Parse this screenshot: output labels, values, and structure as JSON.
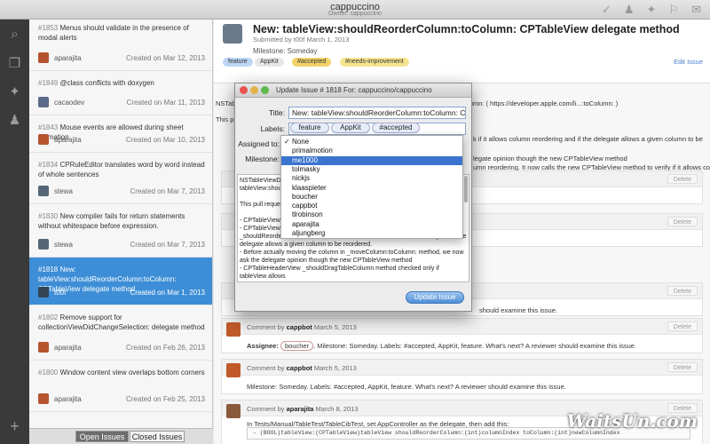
{
  "window": {
    "title": "cappuccino",
    "owner": "Owner: cappuccino"
  },
  "toolbar": {
    "icons": [
      "checkmark-icon",
      "user-icon",
      "milestone-icon",
      "label-icon",
      "comment-icon"
    ],
    "glyphs": [
      "✓",
      "♟",
      "✦",
      "⚐",
      "✉"
    ]
  },
  "sidebar": {
    "icons": [
      "search-icon",
      "document-icon",
      "milestone-icon",
      "user-icon"
    ],
    "glyphs": [
      "⌕",
      "❐",
      "✦",
      "♟"
    ],
    "add": "+"
  },
  "issues": [
    {
      "num": "#1853",
      "title": "Menus should validate in the presence of modal alerts",
      "user": "aparajita",
      "date": "Created on Mar 12, 2013"
    },
    {
      "num": "#1849",
      "title": "@class conflicts with doxygen",
      "user": "cacaodev",
      "date": "Created on Mar 11, 2013"
    },
    {
      "num": "#1843",
      "title": "Mouse events are allowed during sheet animation",
      "user": "aparajita",
      "date": "Created on Mar 10, 2013"
    },
    {
      "num": "#1834",
      "title": "CPRuleEditor translates word by word instead of whole sentences",
      "user": "stewa",
      "date": "Created on Mar 7, 2013"
    },
    {
      "num": "#1830",
      "title": "New compiler fails for return statements without whitespace before expression.",
      "user": "stewa",
      "date": "Created on Mar 7, 2013"
    },
    {
      "num": "#1818",
      "title": "New: tableView:shouldReorderColumn:toColumn: CPTableView delegate method",
      "user": "t00f",
      "date": "Created on Mar 1, 2013"
    },
    {
      "num": "#1802",
      "title": "Remove support for collectionViewDidChangeSelection: delegate method",
      "user": "aparajita",
      "date": "Created on Feb 26, 2013"
    },
    {
      "num": "#1800",
      "title": "Window content view overlaps bottom corners",
      "user": "aparajita",
      "date": "Created on Feb 25, 2013"
    }
  ],
  "tabs": {
    "open": "Open Issues",
    "closed": "Closed Issues"
  },
  "detail": {
    "title": "New: tableView:shouldReorderColumn:toColumn: CPTableView delegate method",
    "submitted": "Submitted by t00f March 1, 2013",
    "milestone": "Milestone: Someday",
    "labels": [
      {
        "text": "feature",
        "bg": "#bcd6f4"
      },
      {
        "text": "AppKit",
        "bg": "#e6e6e6"
      },
      {
        "text": "#accepted",
        "bg": "#f2d36a"
      },
      {
        "text": "#needs-improvement",
        "bg": "#f6e58f"
      }
    ],
    "edit": "Edit Issue",
    "desc_line": "NSTableViewDelegate implements the method tableView:shouldReorderColumn:toColumn: ( https://developer.apple.com/li...:toColumn: )",
    "bg_lines": [
      "This pull request adds the method in cappuccino. This is implemented in 4 points:",
      "k if it allows column reordering and if the delegate allows a given column to be",
      "legate opinion though the new CPTableView method",
      "umn reordering. It now calls the new CPTableView method to verify if it allows column"
    ]
  },
  "comments": [
    {
      "by": "Comment by",
      "user": "cappbot",
      "date": "March 5, 2013",
      "assignee": "Assignee:",
      "assignee_val": "boucher",
      "rest": ", Milestone: Someday. Labels: #accepted, AppKit, feature. What's next? A reviewer should examine this issue."
    },
    {
      "by": "Comment by",
      "user": "cappbot",
      "date": "March 5, 2013",
      "milestone": "Milestone: Someday. Labels: #accepted, AppKit, feature. What's next? A reviewer should examine this issue."
    },
    {
      "by": "Comment by",
      "user": "aparajita",
      "date": "March 8, 2013",
      "body": "In Tests/Manual/TableTest/TableCibTest, set AppController as the delegate, then add this:",
      "code": "- (BOOL)tableView:(CPTableView)tableView shouldReorderColumn:(int)columnIndex toColumn:(int)newColumnIndex"
    }
  ],
  "partial_comment": {
    "tail": "should examine this issue."
  },
  "delete": "Delete",
  "sheet": {
    "title": "Update Issue # 1818 For: cappuccino/cappuccino",
    "title_label": "Title:",
    "title_value": "New: tableView:shouldReorderColumn:toColumn: CPTab",
    "labels_label": "Labels:",
    "label_chips": [
      "feature",
      "AppKit",
      "#accepted"
    ],
    "assigned_label": "Assigned to:",
    "milestone_label": "Milestone:",
    "body": "NSTableViewDel... tableView:shoul... #documentation/... Reference.html#... tableView:should...\n\nThis pull request adds the method in cappuccino. This is implemented in 4 points:\n\n- CPTableView registers delegate methods when setting the delegate.\n- CPTableView implements a private method called _shouldReorderColumn:toColumn to check if it allows column reordering and if the delegate allows a given column to be reordered.\n- Before actually moving the column in _moveColumn:toColumn: method, we now ask the delegate opinion though the new CPTableView method\n- CPTableHeaderView _shouldDragTableColumn method checked only if tableView allows",
    "button": "Update Issue"
  },
  "assignees": {
    "options": [
      "None",
      "primalmotion",
      "me1000",
      "tolmasky",
      "nickjs",
      "klaaspieter",
      "boucher",
      "cappbot",
      "tlrobinson",
      "aparajita",
      "aljungberg"
    ],
    "checked": "None",
    "highlighted": "me1000",
    "check_glyph": "✓"
  },
  "watermark": "WaitsUn.com"
}
